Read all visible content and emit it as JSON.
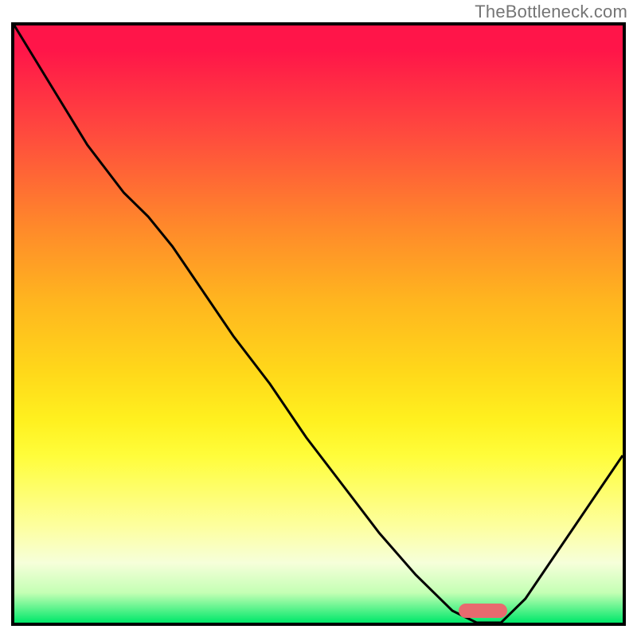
{
  "watermark": "TheBottleneck.com",
  "colors": {
    "border": "#000000",
    "curve": "#000000",
    "spot": "#e86a6f",
    "gradient_top": "#ff1549",
    "gradient_bottom": "#00e86a"
  },
  "chart_data": {
    "type": "line",
    "title": "",
    "xlabel": "",
    "ylabel": "",
    "xlim": [
      0,
      100
    ],
    "ylim": [
      0,
      100
    ],
    "x": [
      0,
      6,
      12,
      18,
      22,
      26,
      30,
      36,
      42,
      48,
      54,
      60,
      66,
      72,
      76,
      80,
      84,
      88,
      92,
      96,
      100
    ],
    "values": [
      100,
      90,
      80,
      72,
      68,
      63,
      57,
      48,
      40,
      31,
      23,
      15,
      8,
      2,
      0,
      0,
      4,
      10,
      16,
      22,
      28
    ],
    "sweet_spot": {
      "x_start": 73,
      "x_end": 81,
      "y": 0
    },
    "annotations": []
  }
}
